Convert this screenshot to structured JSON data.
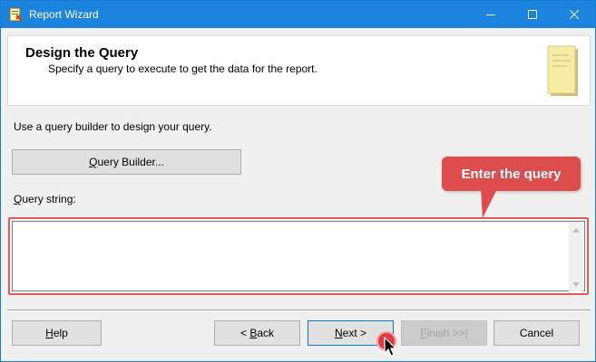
{
  "window": {
    "title": "Report Wizard",
    "icons": {
      "app": "report-wizard-icon",
      "minimize": "minimize-icon",
      "maximize": "maximize-icon",
      "close": "close-icon"
    },
    "titlebar_color": "#1c84de"
  },
  "header": {
    "title": "Design the Query",
    "subtitle": "Specify a query to execute to get the data for the report.",
    "art_icon": "report-page-icon"
  },
  "body": {
    "instruction": "Use a query builder to design your query.",
    "query_builder_button": {
      "prefix": "",
      "mnemonic": "Q",
      "rest": "uery Builder..."
    },
    "query_string_label": {
      "mnemonic": "Q",
      "rest": "uery string:"
    },
    "query_value": "",
    "query_placeholder": ""
  },
  "callout": {
    "text": "Enter the query",
    "color": "#de4d4d"
  },
  "footer": {
    "help": {
      "mnemonic": "H",
      "rest": "elp"
    },
    "back": {
      "prefix": "< ",
      "mnemonic": "B",
      "rest": "ack"
    },
    "next": {
      "mnemonic": "N",
      "rest": "ext >"
    },
    "finish": {
      "mnemonic": "F",
      "rest": "inish >>|"
    },
    "cancel": "Cancel"
  }
}
